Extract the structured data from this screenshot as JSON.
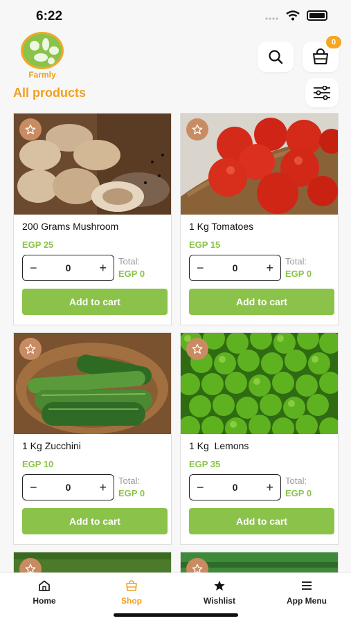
{
  "status": {
    "time": "6:22"
  },
  "header": {
    "logo_text": "Farmly",
    "cart_count": "0"
  },
  "section": {
    "title": "All products"
  },
  "products": [
    {
      "name": "200 Grams Mushroom",
      "price": "EGP 25",
      "qty": "0",
      "total_label": "Total:",
      "total": "EGP 0",
      "button": "Add to cart",
      "image": "mushrooms"
    },
    {
      "name": "1 Kg Tomatoes",
      "price": "EGP 15",
      "qty": "0",
      "total_label": "Total:",
      "total": "EGP 0",
      "button": "Add to cart",
      "image": "tomatoes"
    },
    {
      "name": "1 Kg Zucchini",
      "price": "EGP 10",
      "qty": "0",
      "total_label": "Total:",
      "total": "EGP 0",
      "button": "Add to cart",
      "image": "zucchini"
    },
    {
      "name": "1 Kg  Lemons",
      "price": "EGP 35",
      "qty": "0",
      "total_label": "Total:",
      "total": "EGP 0",
      "button": "Add to cart",
      "image": "limes"
    }
  ],
  "stepper": {
    "minus": "−",
    "plus": "+"
  },
  "nav": {
    "items": [
      {
        "label": "Home",
        "icon": "home-icon"
      },
      {
        "label": "Shop",
        "icon": "bag-icon"
      },
      {
        "label": "Wishlist",
        "icon": "star-icon"
      },
      {
        "label": "App Menu",
        "icon": "menu-icon"
      }
    ],
    "active": "Shop"
  },
  "colors": {
    "accent_green": "#8bc34a",
    "accent_orange": "#f0a020",
    "fav_bg": "#c98b62"
  }
}
